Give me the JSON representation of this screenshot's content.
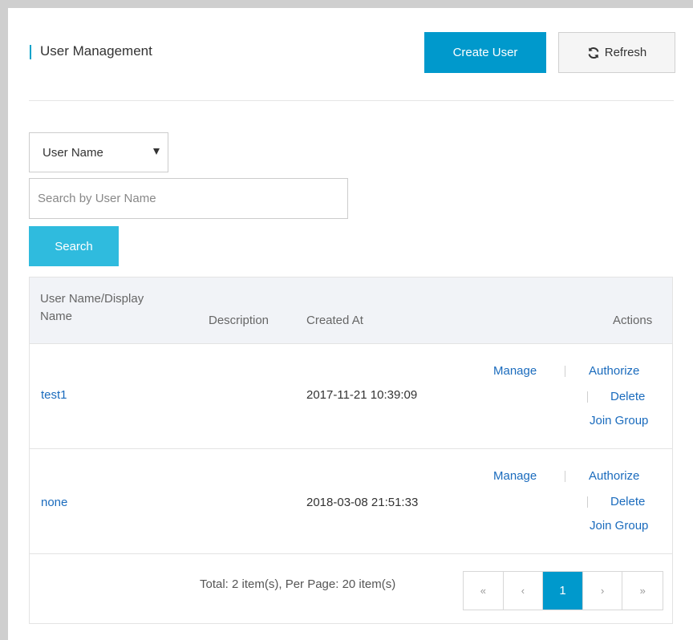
{
  "header": {
    "title": "User Management",
    "create_label": "Create User",
    "refresh_label": "Refresh"
  },
  "filter": {
    "selected_field": "User Name",
    "search_placeholder": "Search by User Name",
    "search_value": "",
    "search_label": "Search"
  },
  "table": {
    "columns": {
      "name_line1": "User Name/Display",
      "name_line2": "Name",
      "description": "Description",
      "created": "Created At",
      "actions": "Actions"
    },
    "rows": [
      {
        "name": "test1",
        "description": "",
        "created": "2017-11-21 10:39:09",
        "manage": "Manage",
        "authorize": "Authorize",
        "delete": "Delete",
        "join_group": "Join Group"
      },
      {
        "name": "none",
        "description": "",
        "created": "2018-03-08 21:51:33",
        "manage": "Manage",
        "authorize": "Authorize",
        "delete": "Delete",
        "join_group": "Join Group"
      }
    ]
  },
  "pagination": {
    "total_text": "Total: 2 item(s), Per Page: 20 item(s)",
    "first": "«",
    "prev": "‹",
    "current": "1",
    "next": "›",
    "last": "»"
  },
  "colors": {
    "primary": "#0099cc",
    "search_button": "#2fbbde",
    "link": "#1a6bbd",
    "header_bg": "#f1f3f7"
  }
}
